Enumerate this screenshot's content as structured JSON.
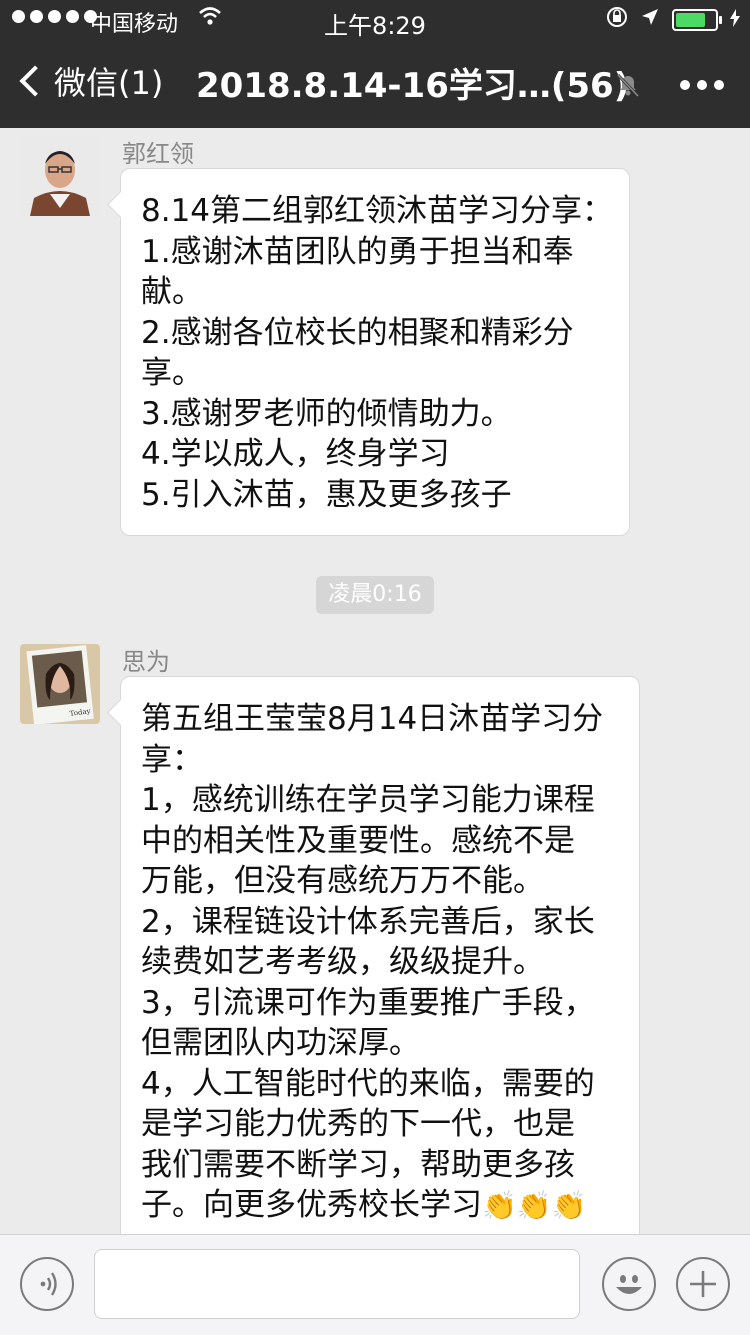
{
  "status_bar": {
    "carrier": "中国移动",
    "time": "上午8:29",
    "battery_level": 0.75
  },
  "nav": {
    "back_label": "微信(1)",
    "title": "2018.8.14-16学习…(56)"
  },
  "messages": [
    {
      "sender": "郭红领",
      "lines": [
        "8.14第二组郭红领沐苗学习分享：",
        "1.感谢沐苗团队的勇于担当和奉",
        "献。",
        "2.感谢各位校长的相聚和精彩分",
        "享。",
        "3.感谢罗老师的倾情助力。",
        "4.学以成人，终身学习",
        "5.引入沐苗，惠及更多孩子"
      ]
    },
    {
      "sender": "思为",
      "lines": [
        "第五组王莹莹8月14日沐苗学习分",
        "享：",
        "1，感统训练在学员学习能力课程",
        "中的相关性及重要性。感统不是",
        "万能，但没有感统万万不能。",
        "2，课程链设计体系完善后，家长",
        "续费如艺考考级，级级提升。",
        "3，引流课可作为重要推广手段，",
        "但需团队内功深厚。",
        "4，人工智能时代的来临，需要的",
        "是学习能力优秀的下一代，也是",
        "我们需要不断学习，帮助更多孩",
        "子。向更多优秀校长学习"
      ]
    }
  ],
  "timestamp": "凌晨0:16",
  "colors": {
    "nav_bg": "#2e2e2e",
    "chat_bg": "#ebebeb",
    "bubble_bg": "#ffffff",
    "battery_green": "#4cd964"
  },
  "icons": {
    "clap": "clapping-hands-icon",
    "voice": "voice-icon",
    "emoji": "emoji-icon",
    "plus": "plus-icon",
    "mute": "mute-bell-icon",
    "more": "more-icon"
  }
}
